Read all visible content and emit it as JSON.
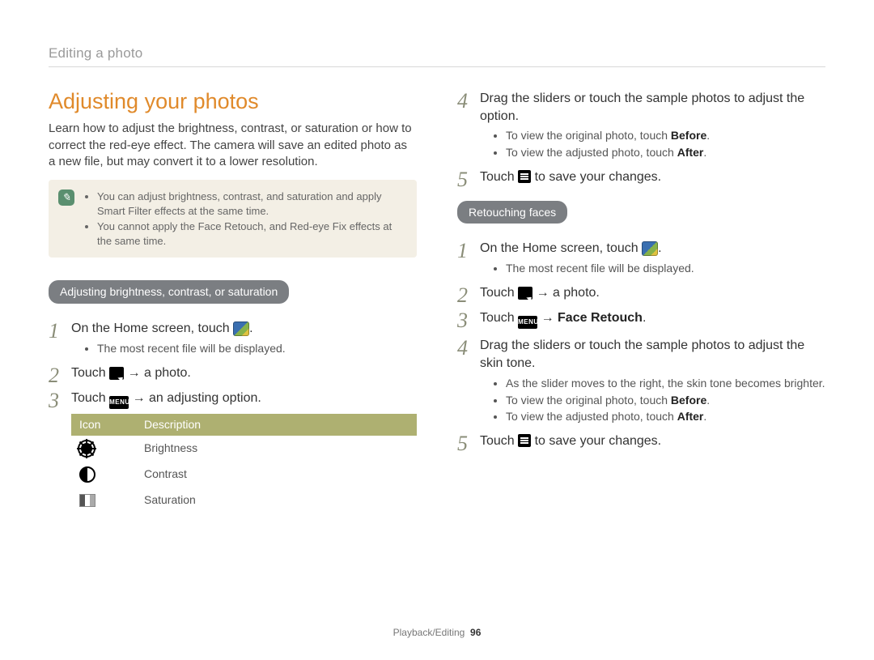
{
  "breadcrumb": "Editing a photo",
  "title": "Adjusting your photos",
  "intro": "Learn how to adjust the brightness, contrast, or saturation or how to correct the red-eye effect. The camera will save an edited photo as a new file, but may convert it to a lower resolution.",
  "note": {
    "items": [
      "You can adjust brightness, contrast, and saturation and apply Smart Filter effects at the same time.",
      "You cannot apply the Face Retouch, and Red-eye Fix effects at the same time."
    ]
  },
  "sectionA": {
    "heading": "Adjusting brightness, contrast, or saturation",
    "step1": "On the Home screen, touch ",
    "step1_sub": "The most recent file will be displayed.",
    "step2_a": "Touch ",
    "step2_b": " → a photo.",
    "step3_a": "Touch ",
    "step3_b": " → an adjusting option.",
    "menu_label": "MENU",
    "table": {
      "h1": "Icon",
      "h2": "Description",
      "r1": "Brightness",
      "r2": "Contrast",
      "r3": "Saturation"
    }
  },
  "right": {
    "step4": "Drag the sliders or touch the sample photos to adjust the option.",
    "step4_sub1_a": "To view the original photo, touch ",
    "step4_sub1_b": "Before",
    "step4_sub2_a": "To view the adjusted photo, touch ",
    "step4_sub2_b": "After",
    "step5_a": "Touch ",
    "step5_b": " to save your changes."
  },
  "sectionB": {
    "heading": "Retouching faces",
    "step1": "On the Home screen, touch ",
    "step1_sub": "The most recent file will be displayed.",
    "step2_a": "Touch ",
    "step2_b": " → a photo.",
    "step3_a": "Touch ",
    "step3_b": " → ",
    "step3_bold": "Face Retouch",
    "menu_label": "MENU",
    "step4": "Drag the sliders or touch the sample photos to adjust the skin tone.",
    "step4_sub1": "As the slider moves to the right, the skin tone becomes brighter.",
    "step4_sub2_a": "To view the original photo, touch ",
    "step4_sub2_b": "Before",
    "step4_sub3_a": "To view the adjusted photo, touch ",
    "step4_sub3_b": "After",
    "step5_a": "Touch ",
    "step5_b": " to save your changes."
  },
  "footer": {
    "section": "Playback/Editing",
    "page": "96"
  }
}
